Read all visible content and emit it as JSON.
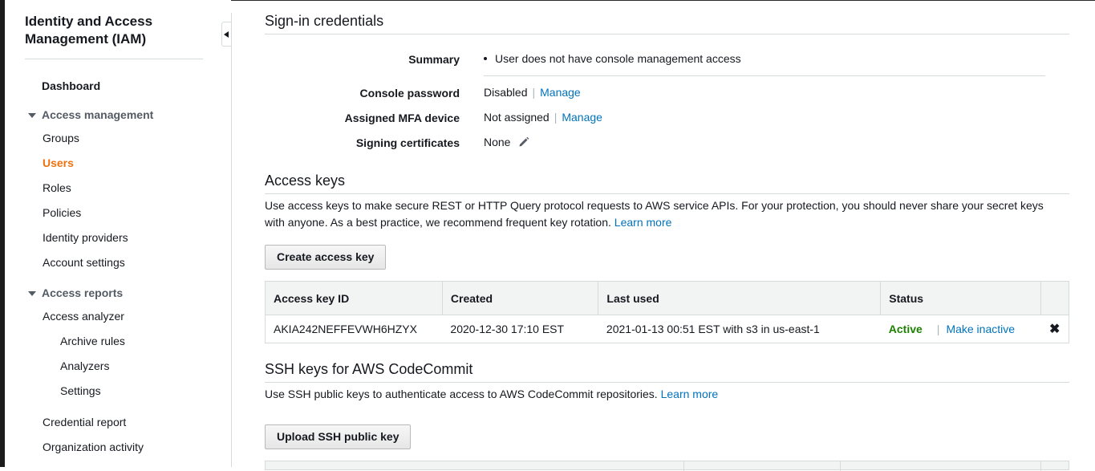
{
  "sidebar": {
    "title": "Identity and Access Management (IAM)",
    "dashboard": "Dashboard",
    "access_management": {
      "label": "Access management",
      "items": [
        "Groups",
        "Users",
        "Roles",
        "Policies",
        "Identity providers",
        "Account settings"
      ],
      "active": "Users"
    },
    "access_reports": {
      "label": "Access reports",
      "analyzer": "Access analyzer",
      "analyzer_items": [
        "Archive rules",
        "Analyzers",
        "Settings"
      ],
      "items": [
        "Credential report",
        "Organization activity"
      ]
    }
  },
  "signin": {
    "title": "Sign-in credentials",
    "summary_label": "Summary",
    "summary_text": "User does not have console management access",
    "console_password_label": "Console password",
    "console_password_value": "Disabled",
    "mfa_label": "Assigned MFA device",
    "mfa_value": "Not assigned",
    "manage_link": "Manage",
    "signing_label": "Signing certificates",
    "signing_value": "None"
  },
  "access_keys": {
    "title": "Access keys",
    "description": "Use access keys to make secure REST or HTTP Query protocol requests to AWS service APIs. For your protection, you should never share your secret keys with anyone. As a best practice, we recommend frequent key rotation.",
    "learn_more": "Learn more",
    "create_button": "Create access key",
    "columns": [
      "Access key ID",
      "Created",
      "Last used",
      "Status"
    ],
    "rows": [
      {
        "id": "AKIA242NEFFEVWH6HZYX",
        "created": "2020-12-30 17:10 EST",
        "last_used": "2021-01-13 00:51 EST with s3 in us-east-1",
        "status": "Active",
        "action": "Make inactive"
      }
    ]
  },
  "ssh": {
    "title": "SSH keys for AWS CodeCommit",
    "description": "Use SSH public keys to authenticate access to AWS CodeCommit repositories.",
    "learn_more": "Learn more",
    "upload_button": "Upload SSH public key"
  },
  "colors": {
    "link": "#0073bb",
    "active_nav": "#ec7211",
    "status_active": "#1d8102"
  }
}
